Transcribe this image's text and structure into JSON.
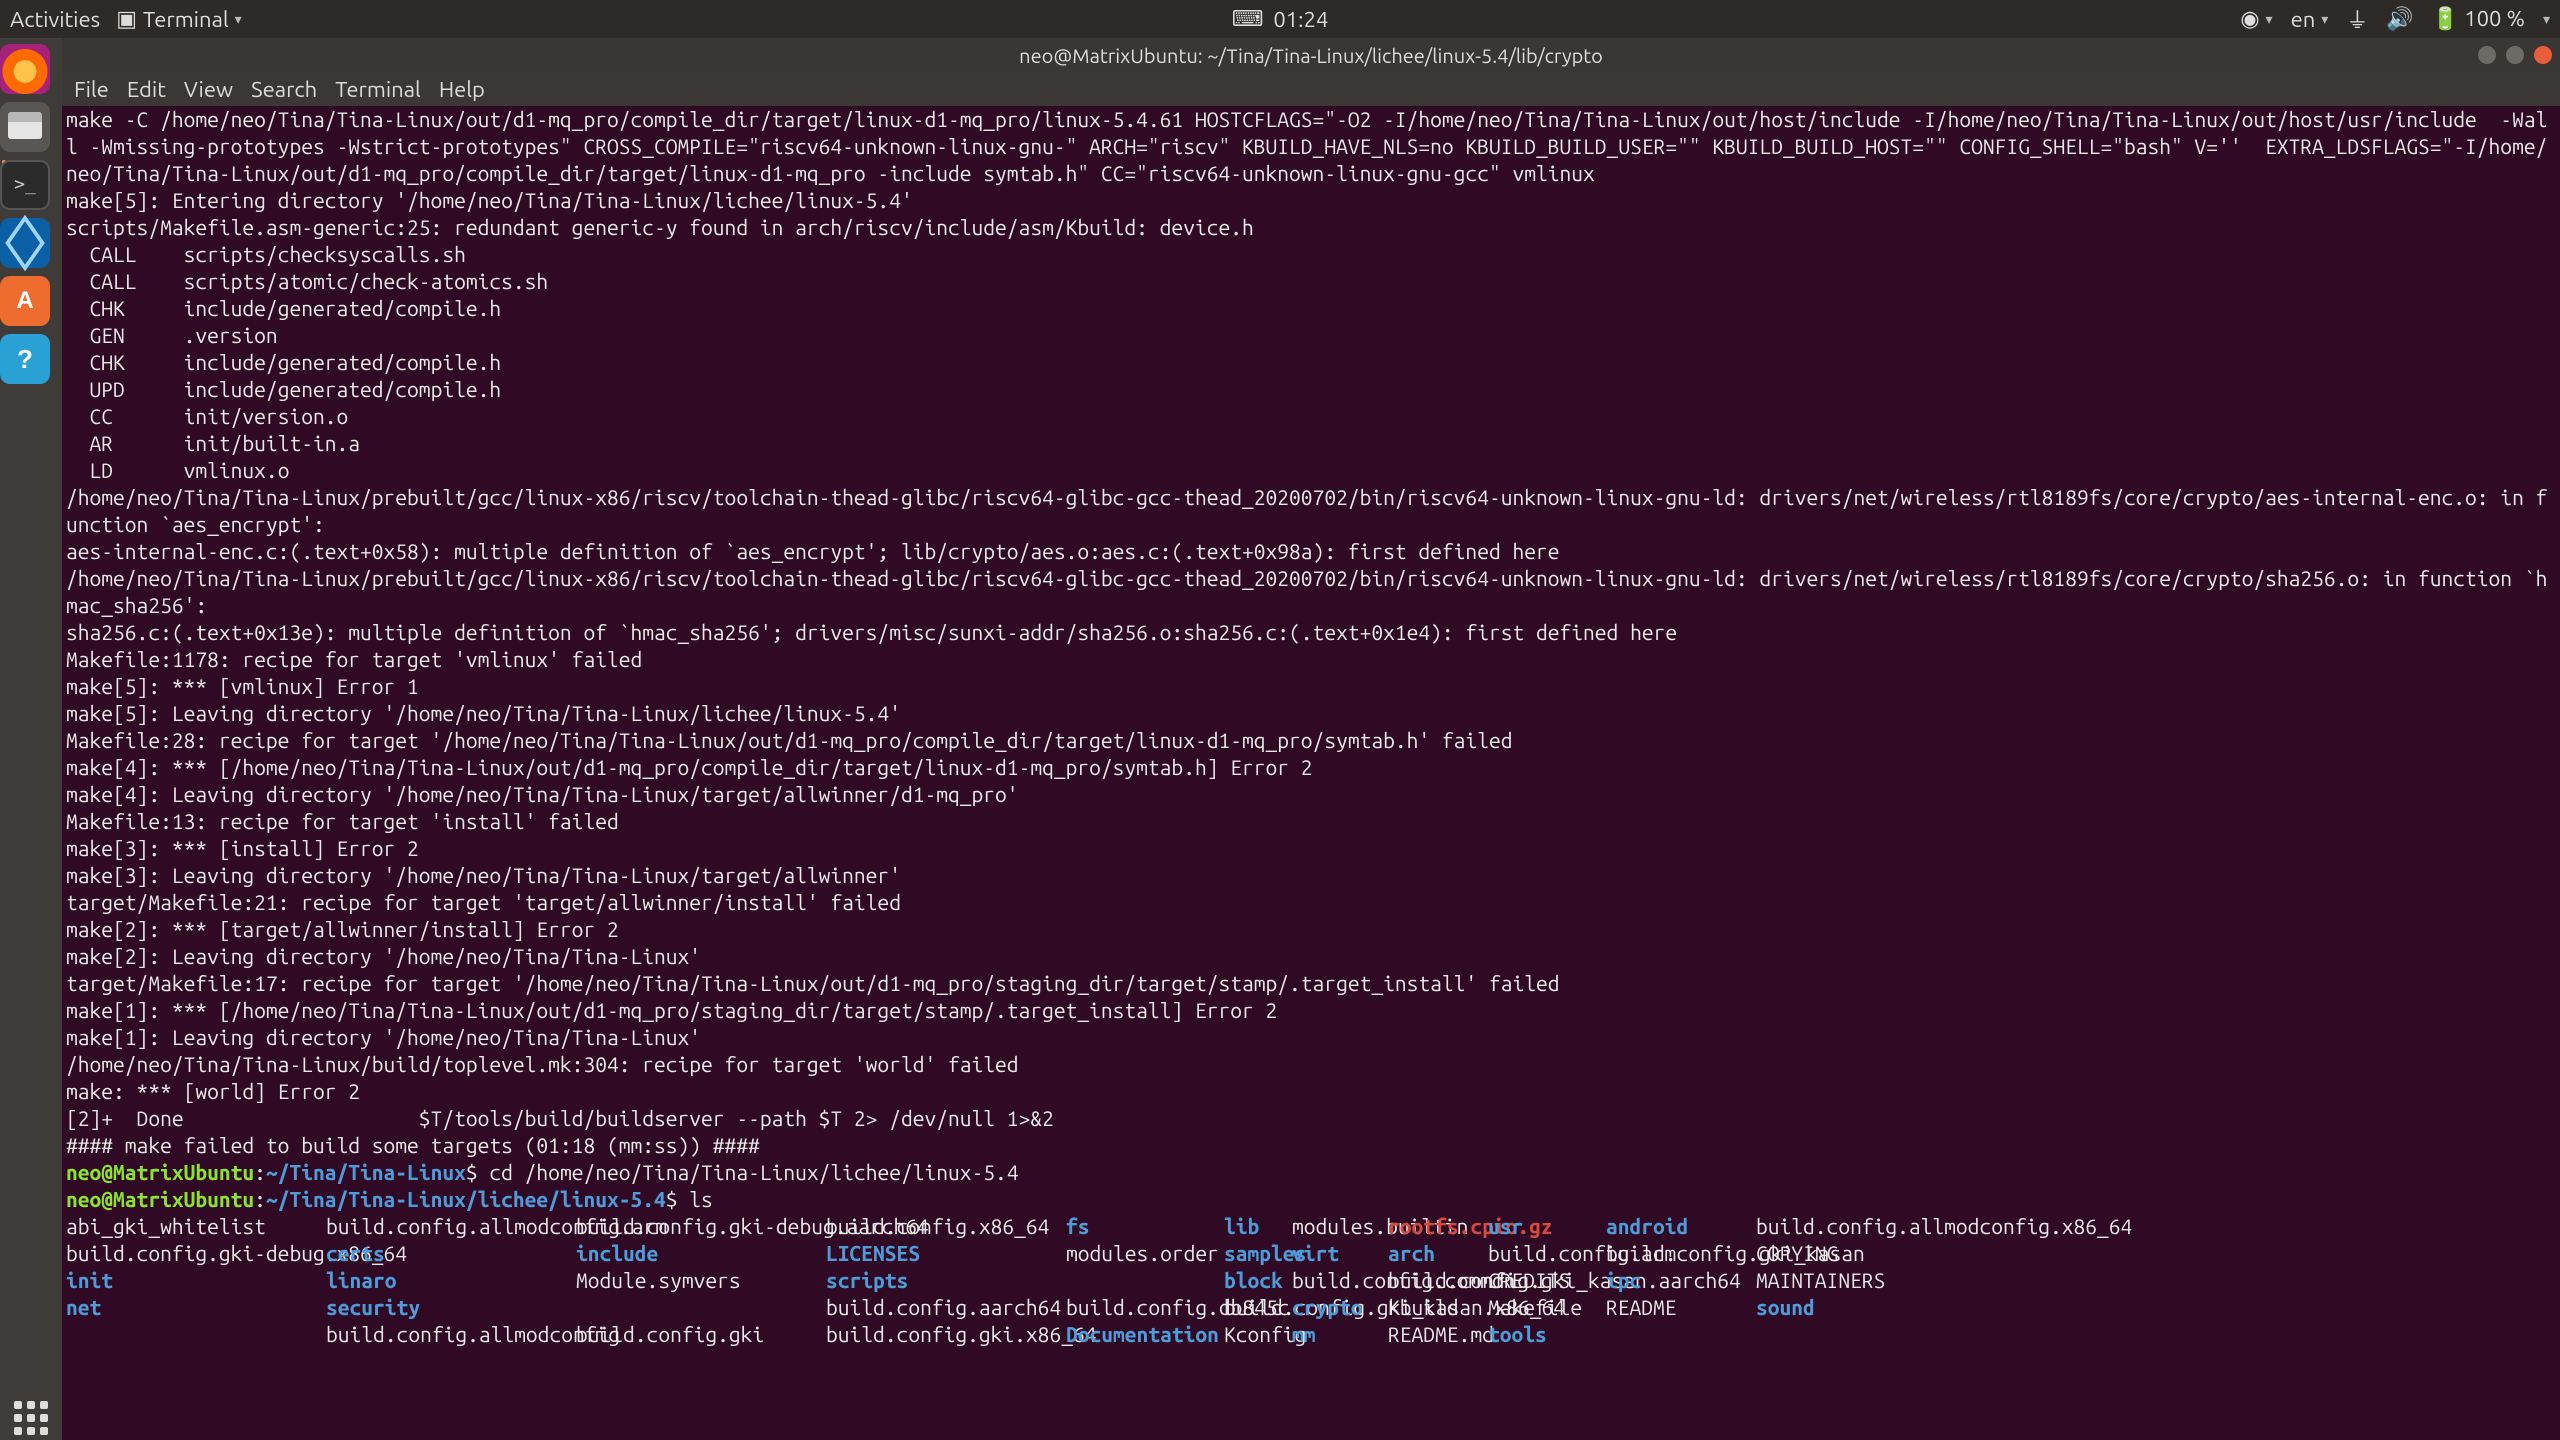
{
  "topbar": {
    "activities": "Activities",
    "app_menu": "Terminal",
    "clock": "01:24",
    "lang": "en",
    "battery": "100 %"
  },
  "window": {
    "title": "neo@MatrixUbuntu: ~/Tina/Tina-Linux/lichee/linux-5.4/lib/crypto",
    "menu": {
      "file": "File",
      "edit": "Edit",
      "view": "View",
      "search": "Search",
      "terminal": "Terminal",
      "help": "Help"
    }
  },
  "prompt": {
    "userhost": "neo@MatrixUbuntu",
    "path1": "~/Tina/Tina-Linux",
    "path2": "~/Tina/Tina-Linux/lichee/linux-5.4",
    "cmd1": "cd /home/neo/Tina/Tina-Linux/lichee/linux-5.4",
    "cmd2": "ls"
  },
  "log": [
    "make -C /home/neo/Tina/Tina-Linux/out/d1-mq_pro/compile_dir/target/linux-d1-mq_pro/linux-5.4.61 HOSTCFLAGS=\"-O2 -I/home/neo/Tina/Tina-Linux/out/host/include -I/home/neo/Tina/Tina-Linux/out/host/usr/include  -Wall -Wmissing-prototypes -Wstrict-prototypes\" CROSS_COMPILE=\"riscv64-unknown-linux-gnu-\" ARCH=\"riscv\" KBUILD_HAVE_NLS=no KBUILD_BUILD_USER=\"\" KBUILD_BUILD_HOST=\"\" CONFIG_SHELL=\"bash\" V=''  EXTRA_LDSFLAGS=\"-I/home/neo/Tina/Tina-Linux/out/d1-mq_pro/compile_dir/target/linux-d1-mq_pro -include symtab.h\" CC=\"riscv64-unknown-linux-gnu-gcc\" vmlinux",
    "make[5]: Entering directory '/home/neo/Tina/Tina-Linux/lichee/linux-5.4'",
    "scripts/Makefile.asm-generic:25: redundant generic-y found in arch/riscv/include/asm/Kbuild: device.h",
    "  CALL    scripts/checksyscalls.sh",
    "  CALL    scripts/atomic/check-atomics.sh",
    "  CHK     include/generated/compile.h",
    "  GEN     .version",
    "  CHK     include/generated/compile.h",
    "  UPD     include/generated/compile.h",
    "  CC      init/version.o",
    "  AR      init/built-in.a",
    "  LD      vmlinux.o",
    "/home/neo/Tina/Tina-Linux/prebuilt/gcc/linux-x86/riscv/toolchain-thead-glibc/riscv64-glibc-gcc-thead_20200702/bin/riscv64-unknown-linux-gnu-ld: drivers/net/wireless/rtl8189fs/core/crypto/aes-internal-enc.o: in function `aes_encrypt':",
    "aes-internal-enc.c:(.text+0x58): multiple definition of `aes_encrypt'; lib/crypto/aes.o:aes.c:(.text+0x98a): first defined here",
    "/home/neo/Tina/Tina-Linux/prebuilt/gcc/linux-x86/riscv/toolchain-thead-glibc/riscv64-glibc-gcc-thead_20200702/bin/riscv64-unknown-linux-gnu-ld: drivers/net/wireless/rtl8189fs/core/crypto/sha256.o: in function `hmac_sha256':",
    "sha256.c:(.text+0x13e): multiple definition of `hmac_sha256'; drivers/misc/sunxi-addr/sha256.o:sha256.c:(.text+0x1e4): first defined here",
    "Makefile:1178: recipe for target 'vmlinux' failed",
    "make[5]: *** [vmlinux] Error 1",
    "make[5]: Leaving directory '/home/neo/Tina/Tina-Linux/lichee/linux-5.4'",
    "Makefile:28: recipe for target '/home/neo/Tina/Tina-Linux/out/d1-mq_pro/compile_dir/target/linux-d1-mq_pro/symtab.h' failed",
    "make[4]: *** [/home/neo/Tina/Tina-Linux/out/d1-mq_pro/compile_dir/target/linux-d1-mq_pro/symtab.h] Error 2",
    "make[4]: Leaving directory '/home/neo/Tina/Tina-Linux/target/allwinner/d1-mq_pro'",
    "Makefile:13: recipe for target 'install' failed",
    "make[3]: *** [install] Error 2",
    "make[3]: Leaving directory '/home/neo/Tina/Tina-Linux/target/allwinner'",
    "target/Makefile:21: recipe for target 'target/allwinner/install' failed",
    "make[2]: *** [target/allwinner/install] Error 2",
    "make[2]: Leaving directory '/home/neo/Tina/Tina-Linux'",
    "target/Makefile:17: recipe for target '/home/neo/Tina/Tina-Linux/out/d1-mq_pro/staging_dir/target/stamp/.target_install' failed",
    "make[1]: *** [/home/neo/Tina/Tina-Linux/out/d1-mq_pro/staging_dir/target/stamp/.target_install] Error 2",
    "make[1]: Leaving directory '/home/neo/Tina/Tina-Linux'",
    "/home/neo/Tina/Tina-Linux/build/toplevel.mk:304: recipe for target 'world' failed",
    "make: *** [world] Error 2",
    "[2]+  Done                    $T/tools/build/buildserver --path $T 2> /dev/null 1>&2",
    "",
    "#### make failed to build some targets (01:18 (mm:ss)) ####",
    ""
  ],
  "ls": {
    "cols": [
      [
        "abi_gki_whitelist",
        "",
        "android",
        "dir",
        "arch",
        "dir",
        "block",
        "dir",
        "build.config.aarch64",
        "",
        "build.config.allmodconfig",
        ""
      ],
      [
        "build.config.allmodconfig.arm",
        "",
        "build.config.allmodconfig.x86_64",
        "",
        "build.config.arm",
        "",
        "build.config.common",
        "",
        "build.config.db845c",
        "",
        "build.config.gki",
        ""
      ],
      [
        "build.config.gki-debug.aarch64",
        "",
        "build.config.gki-debug.x86_64",
        "",
        "build.config.gki_kasan",
        "",
        "build.config.gki_kasan.aarch64",
        "",
        "build.config.gki_kasan.x86_64",
        "",
        "build.config.gki.x86_64",
        ""
      ],
      [
        "build.config.x86_64",
        "",
        "certs",
        "dir",
        "COPYING",
        "",
        "CREDITS",
        "",
        "crypto",
        "dir",
        "Documentation",
        "dir"
      ],
      [
        "fs",
        "dir",
        "include",
        "dir",
        "init",
        "dir",
        "ipc",
        "dir",
        "Kbuild",
        "",
        "Kconfig",
        ""
      ],
      [
        "lib",
        "dir",
        "LICENSES",
        "dir",
        "linaro",
        "dir",
        "MAINTAINERS",
        "",
        "Makefile",
        "",
        "mm",
        "dir"
      ],
      [
        "modules.builtin",
        "",
        "modules.order",
        "",
        "Module.symvers",
        "",
        "net",
        "dir",
        "README",
        "",
        "README.md",
        ""
      ],
      [
        "rootfs.cpio.gz",
        "arc",
        "samples",
        "dir",
        "scripts",
        "dir",
        "security",
        "dir",
        "sound",
        "dir",
        "tools",
        "dir"
      ],
      [
        "usr",
        "dir",
        "virt",
        "dir",
        "",
        "",
        "",
        "",
        "",
        "",
        "",
        ""
      ]
    ]
  }
}
